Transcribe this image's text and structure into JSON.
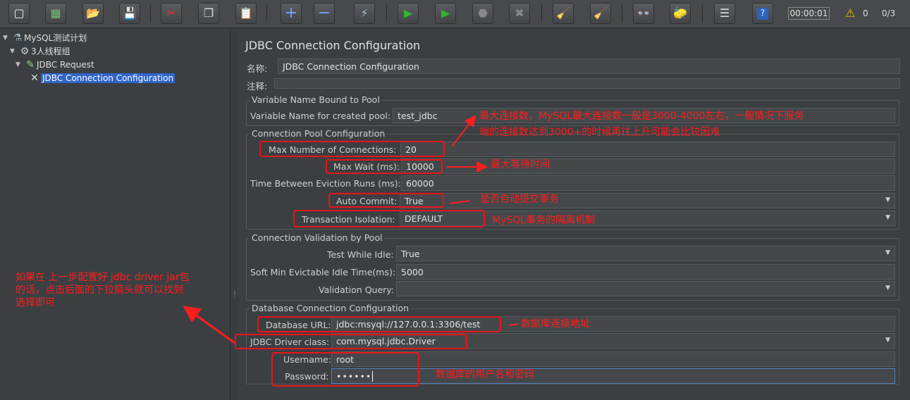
{
  "toolbar": {
    "buttons": [
      {
        "name": "new-icon",
        "glyph": "▢"
      },
      {
        "name": "templates-icon",
        "glyph": "▦"
      },
      {
        "name": "open-icon",
        "glyph": "📂"
      },
      {
        "name": "save-icon",
        "glyph": "💾"
      },
      {
        "name": "cut-icon",
        "glyph": "✂"
      },
      {
        "name": "copy-icon",
        "glyph": "❐"
      },
      {
        "name": "paste-icon",
        "glyph": "📋"
      },
      {
        "name": "expand-icon",
        "glyph": "+"
      },
      {
        "name": "collapse-icon",
        "glyph": "−"
      },
      {
        "name": "toggle-icon",
        "glyph": "⚡"
      },
      {
        "name": "start-icon",
        "glyph": "▶"
      },
      {
        "name": "start-no-pauses-icon",
        "glyph": "▶"
      },
      {
        "name": "stop-icon",
        "glyph": "⬣"
      },
      {
        "name": "shutdown-icon",
        "glyph": "✖"
      },
      {
        "name": "clear-icon",
        "glyph": "🧹"
      },
      {
        "name": "clear-all-icon",
        "glyph": "🧹"
      },
      {
        "name": "search-icon",
        "glyph": "👓"
      },
      {
        "name": "reset-search-icon",
        "glyph": "🧽"
      },
      {
        "name": "function-helper-icon",
        "glyph": "☰"
      },
      {
        "name": "help-icon",
        "glyph": "?"
      }
    ],
    "timer": "00:00:01",
    "warning_count": "0",
    "threads": "0/3"
  },
  "tree": {
    "items": [
      {
        "label": "MySQL测试计划",
        "icon": "flask-icon",
        "glyph": "⚗"
      },
      {
        "label": "3人线程组",
        "icon": "gear-icon",
        "glyph": "⚙"
      },
      {
        "label": "JDBC Request",
        "icon": "pipette-icon",
        "glyph": "✎"
      },
      {
        "label": "JDBC Connection Configuration",
        "icon": "tools-icon",
        "glyph": "✕"
      }
    ]
  },
  "panel": {
    "title": "JDBC Connection Configuration",
    "name_label": "名称:",
    "name_value": "JDBC Connection Configuration",
    "comment_label": "注释:",
    "comment_value": "",
    "pool_var_group": "Variable Name Bound to Pool",
    "pool_var_label": "Variable Name for created pool:",
    "pool_var_value": "test_jdbc",
    "pool_config_group": "Connection Pool Configuration",
    "max_conn_label": "Max Number of Connections:",
    "max_conn_value": "20",
    "max_wait_label": "Max Wait (ms):",
    "max_wait_value": "10000",
    "eviction_label": "Time Between Eviction Runs (ms):",
    "eviction_value": "60000",
    "auto_commit_label": "Auto Commit:",
    "auto_commit_value": "True",
    "isolation_label": "Transaction Isolation:",
    "isolation_value": "DEFAULT",
    "validation_group": "Connection Validation by Pool",
    "test_idle_label": "Test While Idle:",
    "test_idle_value": "True",
    "soft_min_label": "Soft Min Evictable Idle Time(ms):",
    "soft_min_value": "5000",
    "validation_query_label": "Validation Query:",
    "validation_query_value": "",
    "db_group": "Database Connection Configuration",
    "db_url_label": "Database URL:",
    "db_url_value": "jdbc:msyql://127.0.0.1:3306/test",
    "driver_label": "JDBC Driver class:",
    "driver_value": "com.mysql.jdbc.Driver",
    "username_label": "Username:",
    "username_value": "root",
    "password_label": "Password:",
    "password_value": "••••••"
  },
  "annotations": {
    "max_conn_note_line1": "最大连接数，MySQL最大连接数一般是3000-4000左右，一般情况下服务",
    "max_conn_note_line2": "端的连接数达到3000+的时候再往上升可能会比较困难",
    "max_wait_note": "最大等待时间",
    "auto_commit_note": "是否自动提交事务",
    "isolation_note": "MySQL事务的隔离机制",
    "driver_note_line1": "如果在 上一步配置好 jdbc driver jar包",
    "driver_note_line2": "的话，点击后面的下拉箭头就可以找到",
    "driver_note_line3": "选择即可",
    "db_url_note": "数据库连接地址",
    "credentials_note": "数据库的用户名和密码"
  }
}
